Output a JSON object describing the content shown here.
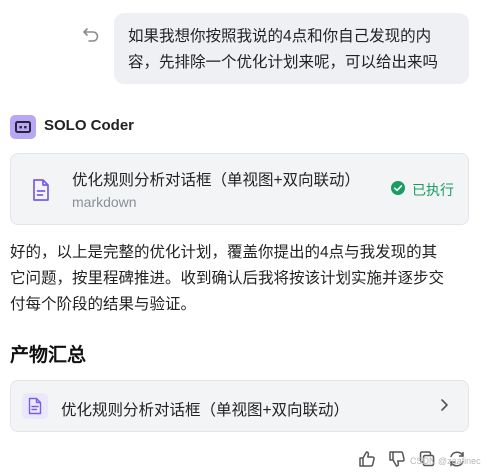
{
  "user_message": {
    "line1": "如果我想你按照我说的4点和你自己发现的内",
    "line2": "容，先排除一个优化计划来呢，可以给出来吗"
  },
  "agent": {
    "name": "SOLO Coder"
  },
  "task_card": {
    "title": "优化规则分析对话框（单视图+双向联动）",
    "subtitle": "markdown",
    "status": "已执行",
    "status_color": "#1a9c63"
  },
  "reply": {
    "line1": "好的，以上是完整的优化计划，覆盖你提出的4点与我发现的其",
    "line2": "它问题，按里程碑推进。收到确认后我将按该计划实施并逐步交",
    "line3": "付每个阶段的结果与验证。"
  },
  "artifacts": {
    "heading": "产物汇总",
    "items": [
      {
        "title": "优化规则分析对话框（单视图+双向联动）"
      }
    ]
  },
  "toolbar": {
    "icons": [
      "thumbs-up-icon",
      "thumbs-down-icon",
      "copy-icon",
      "refresh-icon"
    ]
  },
  "watermark": "CSDN @zaafinec",
  "accent_color": "#7b5ce5"
}
